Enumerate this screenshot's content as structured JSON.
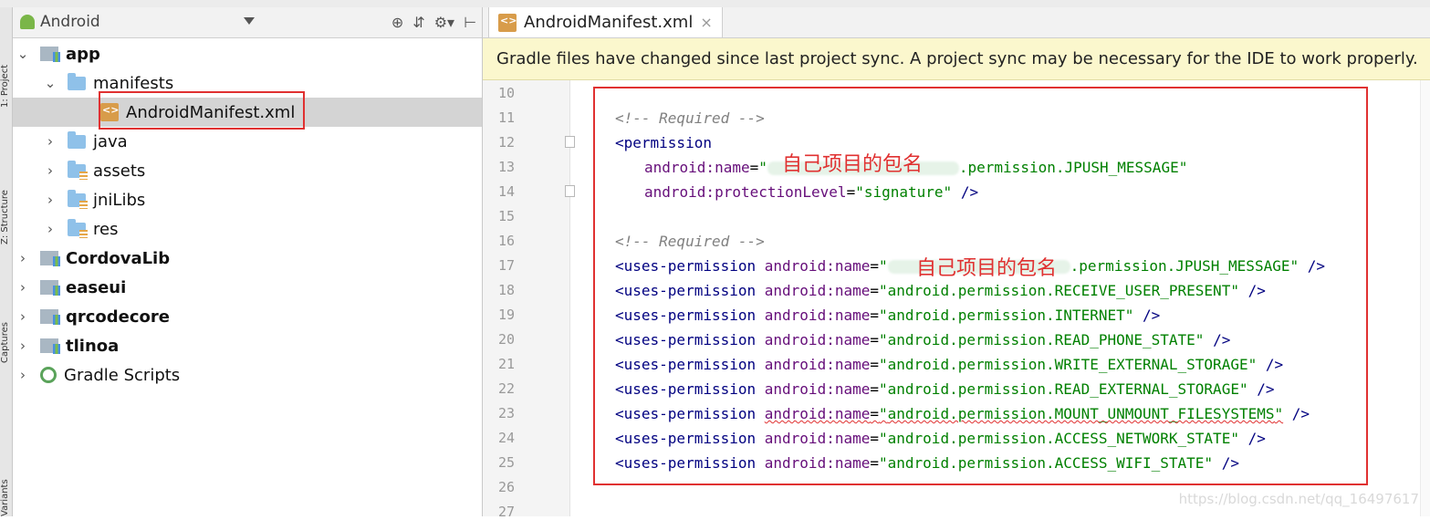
{
  "left_toolstrip": {
    "tabs": [
      "1: Project",
      "Z: Structure",
      "Captures",
      "Variants"
    ]
  },
  "project_panel": {
    "view_label": "Android",
    "tree": [
      {
        "label": "app",
        "bold": true,
        "expanded": true
      },
      {
        "label": "manifests",
        "expanded": true
      },
      {
        "label": "AndroidManifest.xml",
        "selected": true
      },
      {
        "label": "java"
      },
      {
        "label": "assets"
      },
      {
        "label": "jniLibs"
      },
      {
        "label": "res"
      },
      {
        "label": "CordovaLib",
        "bold": true
      },
      {
        "label": "easeui",
        "bold": true
      },
      {
        "label": "qrcodecore",
        "bold": true
      },
      {
        "label": "tlinoa",
        "bold": true
      },
      {
        "label": "Gradle Scripts"
      }
    ]
  },
  "editor": {
    "tab_label": "AndroidManifest.xml",
    "close_glyph": "×",
    "banner": "Gradle files have changed since last project sync. A project sync may be necessary for the IDE to work properly.",
    "line_numbers": [
      "10",
      "11",
      "12",
      "13",
      "14",
      "15",
      "16",
      "17",
      "18",
      "19",
      "20",
      "21",
      "22",
      "23",
      "24",
      "25",
      "26",
      "27"
    ],
    "comment_required": "<!-- Required -->",
    "permission_open": "<permission",
    "attr_name": "android:name",
    "attr_protection": "android:protectionLevel",
    "value_signature": "\"signature\"",
    "jpush_suffix": "permission.JPUSH_MESSAGE",
    "uses_tag": "<uses-permission",
    "uses_permissions": [
      "android.permission.RECEIVE_USER_PRESENT",
      "android.permission.INTERNET",
      "android.permission.READ_PHONE_STATE",
      "android.permission.WRITE_EXTERNAL_STORAGE",
      "android.permission.READ_EXTERNAL_STORAGE",
      "android.permission.MOUNT_UNMOUNT_FILESYSTEMS",
      "android.permission.ACCESS_NETWORK_STATE",
      "android.permission.ACCESS_WIFI_STATE"
    ],
    "annotation": "自己项目的包名",
    "watermark": "https://blog.csdn.net/qq_16497617"
  },
  "colors": {
    "tag": "#000080",
    "attr": "#660e7a",
    "value": "#008000",
    "comment": "#808080",
    "highlight_box": "#e03131",
    "banner_bg": "#fbf7cd"
  }
}
